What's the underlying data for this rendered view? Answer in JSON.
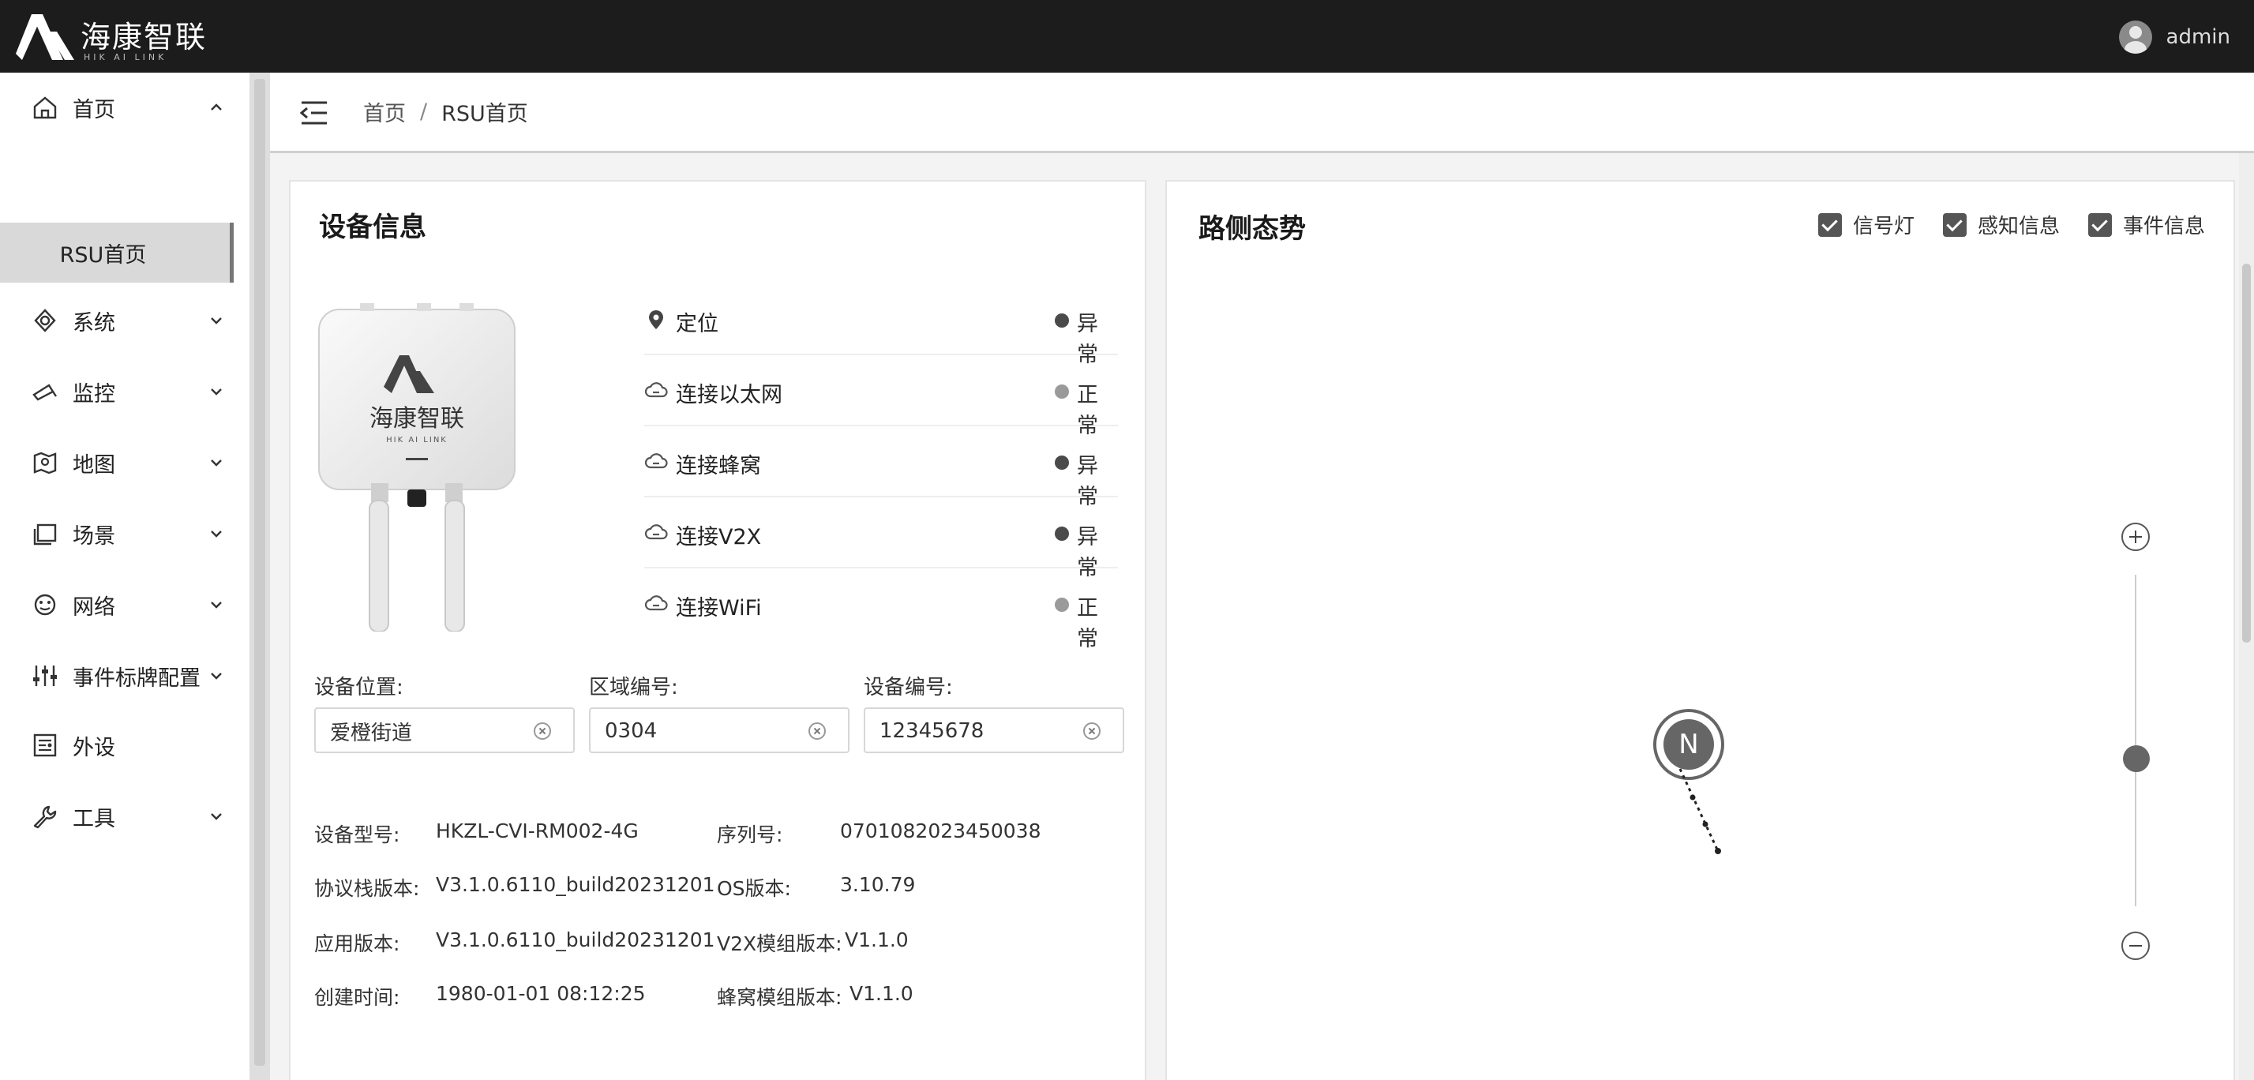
{
  "header": {
    "brand": "海康智联",
    "brand_sub": "HIK AI LINK",
    "user": "admin"
  },
  "sidebar": {
    "items": [
      {
        "label": "首页",
        "icon": "home-icon",
        "expanded": true
      },
      {
        "label": "系统",
        "icon": "system-icon"
      },
      {
        "label": "监控",
        "icon": "monitor-icon"
      },
      {
        "label": "地图",
        "icon": "map-icon"
      },
      {
        "label": "场景",
        "icon": "scene-icon"
      },
      {
        "label": "网络",
        "icon": "network-icon"
      },
      {
        "label": "事件标牌配置",
        "icon": "sliders-icon"
      },
      {
        "label": "外设",
        "icon": "peripheral-icon"
      },
      {
        "label": "工具",
        "icon": "wrench-icon"
      }
    ],
    "sub_item": "RSU首页"
  },
  "breadcrumb": {
    "root": "首页",
    "separator": "/",
    "current": "RSU首页"
  },
  "device": {
    "title": "设备信息",
    "status": [
      {
        "label": "定位",
        "icon": "location-icon",
        "value": "异常",
        "color": "#4a4a4a"
      },
      {
        "label": "连接以太网",
        "icon": "cloud-link-icon",
        "value": "正常",
        "color": "#9a9a9a"
      },
      {
        "label": "连接蜂窝",
        "icon": "cloud-link-icon",
        "value": "异常",
        "color": "#4a4a4a"
      },
      {
        "label": "连接V2X",
        "icon": "cloud-link-icon",
        "value": "异常",
        "color": "#4a4a4a"
      },
      {
        "label": "连接WiFi",
        "icon": "cloud-link-icon",
        "value": "正常",
        "color": "#9a9a9a"
      }
    ],
    "fields": [
      {
        "label": "设备位置:",
        "value": "爱橙街道"
      },
      {
        "label": "区域编号:",
        "value": "0304"
      },
      {
        "label": "设备编号:",
        "value": "12345678"
      }
    ],
    "info": [
      {
        "key": "设备型号:",
        "value": "HKZL-CVI-RM002-4G"
      },
      {
        "key": "序列号:",
        "value": "0701082023450038"
      },
      {
        "key": "协议栈版本:",
        "value": "V3.1.0.6110_build20231201"
      },
      {
        "key": "OS版本:",
        "value": "3.10.79"
      },
      {
        "key": "应用版本:",
        "value": "V3.1.0.6110_build20231201"
      },
      {
        "key": "V2X模组版本:",
        "value": "V1.1.0"
      },
      {
        "key": "创建时间:",
        "value": "1980-01-01 08:12:25"
      },
      {
        "key": "蜂窝模组版本:",
        "value": "V1.1.0"
      }
    ],
    "image_brand": "海康智联",
    "image_brand_sub": "HIK AI LINK"
  },
  "road": {
    "title": "路侧态势",
    "checks": [
      {
        "label": "信号灯",
        "checked": true
      },
      {
        "label": "感知信息",
        "checked": true
      },
      {
        "label": "事件信息",
        "checked": true
      }
    ],
    "compass": "N",
    "zoom_level": 0.5
  }
}
